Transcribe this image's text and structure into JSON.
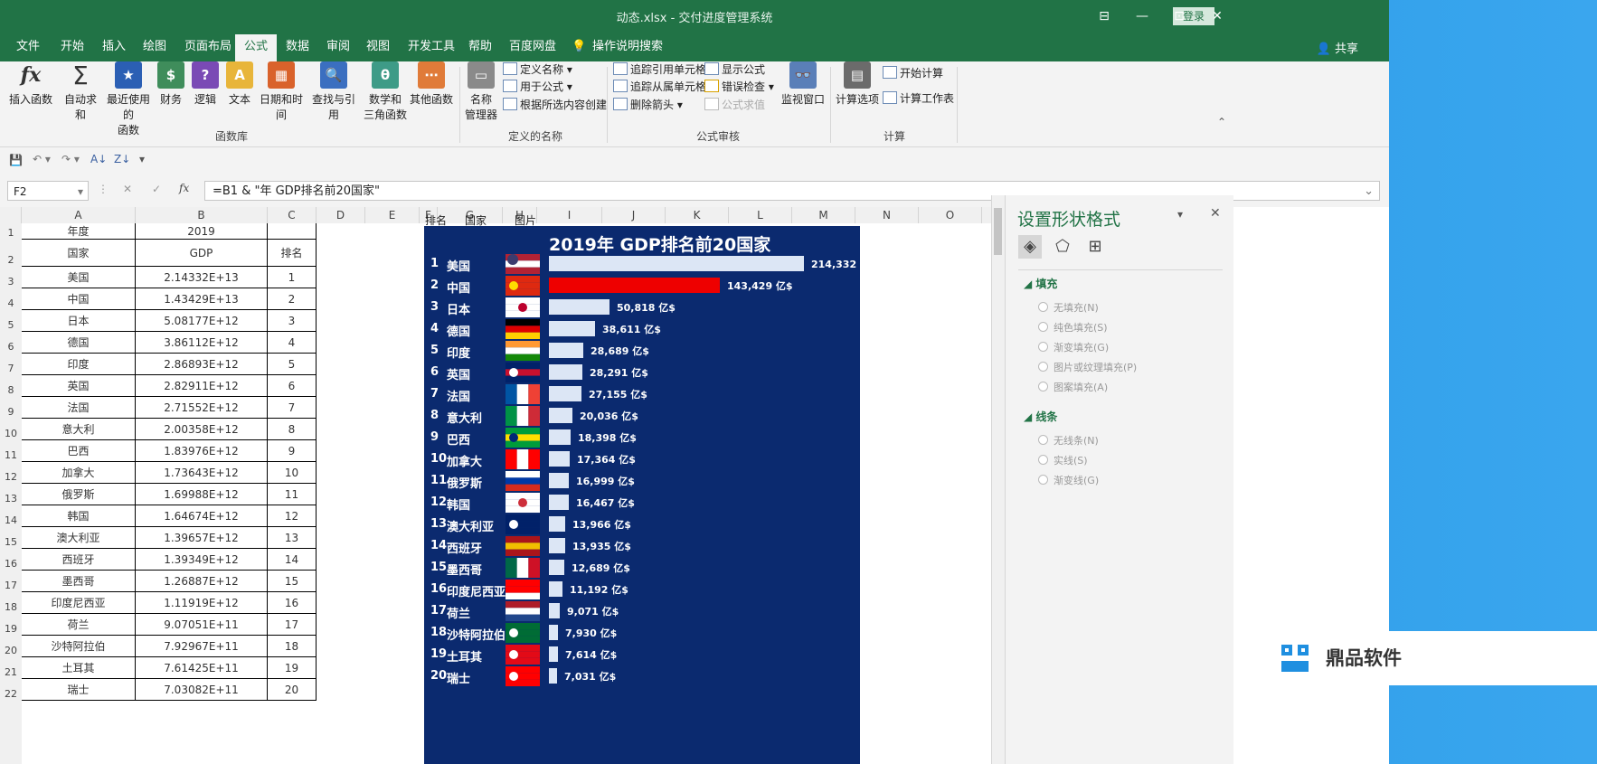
{
  "window": {
    "title": "动态.xlsx - 交付进度管理系统",
    "login_label": "登录",
    "minimize": "—",
    "restore": "⊡",
    "close": "✕",
    "ribbon_toggle": "⊟"
  },
  "tabs": [
    "文件",
    "开始",
    "插入",
    "绘图",
    "页面布局",
    "公式",
    "数据",
    "审阅",
    "视图",
    "开发工具",
    "帮助",
    "百度网盘",
    "操作说明搜索"
  ],
  "active_tab": "公式",
  "share_label": "共享",
  "ribbon": {
    "insert_function": "插入函数",
    "autosum": "自动求和",
    "recent_line1": "最近使用的",
    "recent_line2": "函数",
    "financial": "财务",
    "logical": "逻辑",
    "text": "文本",
    "datetime": "日期和时间",
    "lookup": "查找与引用",
    "math_line1": "数学和",
    "math_line2": "三角函数",
    "more": "其他函数",
    "group_library": "函数库",
    "name_manager_line1": "名称",
    "name_manager_line2": "管理器",
    "define_name": "定义名称",
    "use_in_formula": "用于公式",
    "create_from_selection": "根据所选内容创建",
    "group_names": "定义的名称",
    "trace_precedents": "追踪引用单元格",
    "trace_dependents": "追踪从属单元格",
    "remove_arrows": "删除箭头",
    "show_formulas": "显示公式",
    "error_checking": "错误检查",
    "evaluate_formula": "公式求值",
    "watch_window": "监视窗口",
    "group_auditing": "公式审核",
    "calc_options": "计算选项",
    "calc_now": "开始计算",
    "calc_sheet": "计算工作表",
    "group_calc": "计算"
  },
  "formula_bar": {
    "name_box": "F2",
    "fx": "fx",
    "formula": "=B1 & \"年 GDP排名前20国家\""
  },
  "columns": [
    "A",
    "B",
    "C",
    "D",
    "E",
    "F",
    "G",
    "H",
    "I",
    "J",
    "K",
    "L",
    "M",
    "N",
    "O"
  ],
  "rows": [
    "1",
    "2",
    "3",
    "4",
    "5",
    "6",
    "7",
    "8",
    "9",
    "10",
    "11",
    "12",
    "13",
    "14",
    "15",
    "16",
    "17",
    "18",
    "19",
    "20",
    "21",
    "22"
  ],
  "table": {
    "year_label": "年度",
    "year_value": "2019",
    "country_header": "国家",
    "gdp_header": "GDP",
    "rank_header": "排名",
    "rows": [
      {
        "country": "美国",
        "gdp": "2.14332E+13",
        "rank": "1"
      },
      {
        "country": "中国",
        "gdp": "1.43429E+13",
        "rank": "2"
      },
      {
        "country": "日本",
        "gdp": "5.08177E+12",
        "rank": "3"
      },
      {
        "country": "德国",
        "gdp": "3.86112E+12",
        "rank": "4"
      },
      {
        "country": "印度",
        "gdp": "2.86893E+12",
        "rank": "5"
      },
      {
        "country": "英国",
        "gdp": "2.82911E+12",
        "rank": "6"
      },
      {
        "country": "法国",
        "gdp": "2.71552E+12",
        "rank": "7"
      },
      {
        "country": "意大利",
        "gdp": "2.00358E+12",
        "rank": "8"
      },
      {
        "country": "巴西",
        "gdp": "1.83976E+12",
        "rank": "9"
      },
      {
        "country": "加拿大",
        "gdp": "1.73643E+12",
        "rank": "10"
      },
      {
        "country": "俄罗斯",
        "gdp": "1.69988E+12",
        "rank": "11"
      },
      {
        "country": "韩国",
        "gdp": "1.64674E+12",
        "rank": "12"
      },
      {
        "country": "澳大利亚",
        "gdp": "1.39657E+12",
        "rank": "13"
      },
      {
        "country": "西班牙",
        "gdp": "1.39349E+12",
        "rank": "14"
      },
      {
        "country": "墨西哥",
        "gdp": "1.26887E+12",
        "rank": "15"
      },
      {
        "country": "印度尼西亚",
        "gdp": "1.11919E+12",
        "rank": "16"
      },
      {
        "country": "荷兰",
        "gdp": "9.07051E+11",
        "rank": "17"
      },
      {
        "country": "沙特阿拉伯",
        "gdp": "7.92967E+11",
        "rank": "18"
      },
      {
        "country": "土耳其",
        "gdp": "7.61425E+11",
        "rank": "19"
      },
      {
        "country": "瑞士",
        "gdp": "7.03082E+11",
        "rank": "20"
      }
    ]
  },
  "chart_headers": {
    "rank": "排名",
    "country": "国家",
    "image": "图片"
  },
  "chart_data": {
    "type": "bar",
    "title": "2019年 GDP排名前20国家",
    "unit_suffix": " 亿$",
    "categories": [
      "美国",
      "中国",
      "日本",
      "德国",
      "印度",
      "英国",
      "法国",
      "意大利",
      "巴西",
      "加拿大",
      "俄罗斯",
      "韩国",
      "澳大利亚",
      "西班牙",
      "墨西哥",
      "印度尼西亚",
      "荷兰",
      "沙特阿拉伯",
      "土耳其",
      "瑞士"
    ],
    "values": [
      214332,
      143429,
      50818,
      38611,
      28689,
      28291,
      27155,
      20036,
      18398,
      17364,
      16999,
      16467,
      13966,
      13935,
      12689,
      11192,
      9071,
      7930,
      7614,
      7031
    ],
    "labels": [
      "214,332",
      "143,429",
      "50,818",
      "38,611",
      "28,689",
      "28,291",
      "27,155",
      "20,036",
      "18,398",
      "17,364",
      "16,999",
      "16,467",
      "13,966",
      "13,935",
      "12,689",
      "11,192",
      "9,071",
      "7,930",
      "7,614",
      "7,031"
    ],
    "highlight_index": 1,
    "bar_color": "#dce6f5",
    "highlight_color": "#ee0000",
    "background": "#0b2a6f",
    "xlim": [
      0,
      214332
    ]
  },
  "pane": {
    "title": "设置形状格式",
    "fill_section": "填充",
    "fill_options": [
      "无填充(N)",
      "纯色填充(S)",
      "渐变填充(G)",
      "图片或纹理填充(P)",
      "图案填充(A)"
    ],
    "line_section": "线条",
    "line_options": [
      "无线条(N)",
      "实线(S)",
      "渐变线(G)"
    ]
  },
  "watermark": "鼎品软件",
  "colors": {
    "excel_green": "#217346",
    "chart_bg": "#0b2a6f"
  }
}
